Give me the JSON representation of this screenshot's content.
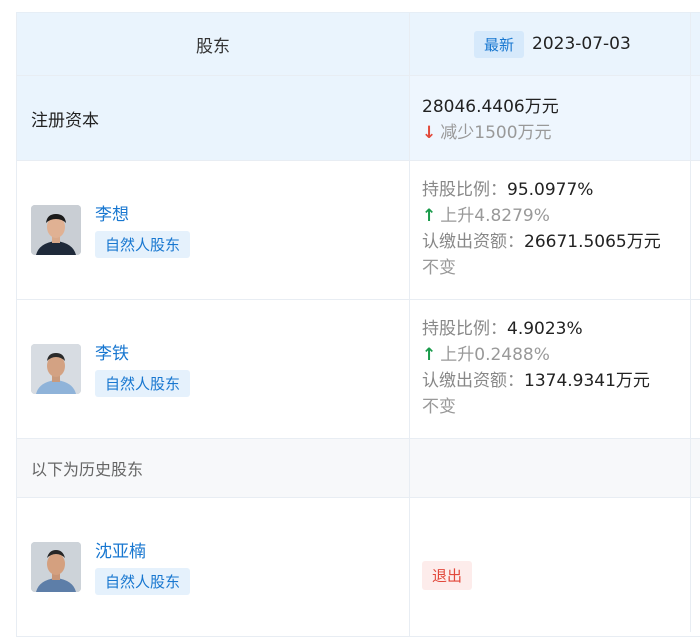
{
  "header": {
    "shareholder_col": "股东",
    "latest_badge": "最新",
    "date": "2023-07-03"
  },
  "capital": {
    "label": "注册资本",
    "value": "28046.4406万元",
    "change_icon": "arrow-down",
    "change_text": "减少1500万元"
  },
  "shareholders": [
    {
      "name": "李想",
      "type": "自然人股东",
      "ratio_label": "持股比例：",
      "ratio_value": "95.0977%",
      "ratio_change_icon": "arrow-up",
      "ratio_change": "上升4.8279%",
      "capital_label": "认缴出资额：",
      "capital_value": "26671.5065万元",
      "capital_change": "不变"
    },
    {
      "name": "李铁",
      "type": "自然人股东",
      "ratio_label": "持股比例：",
      "ratio_value": "4.9023%",
      "ratio_change_icon": "arrow-up",
      "ratio_change": "上升0.2488%",
      "capital_label": "认缴出资额：",
      "capital_value": "1374.9341万元",
      "capital_change": "不变"
    }
  ],
  "history": {
    "label": "以下为历史股东"
  },
  "historical_shareholders": [
    {
      "name": "沈亚楠",
      "type": "自然人股东",
      "status": "退出"
    }
  ],
  "colors": {
    "header_bg": "#eaf4fd",
    "accent_blue": "#1877d0",
    "up_green": "#1a9b4b",
    "down_red": "#e24a3b",
    "exit_red": "#e2483b"
  }
}
